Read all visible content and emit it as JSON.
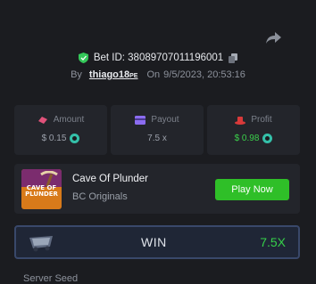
{
  "bet": {
    "id_label": "Bet ID: 38089707011196001",
    "by_label": "By",
    "username": "thiago18",
    "username_suffix": "PE",
    "on_label": "On",
    "date": "9/5/2023, 20:53:16"
  },
  "stats": {
    "amount": {
      "label": "Amount",
      "value": "$ 0.15",
      "color": "#e0527a"
    },
    "payout": {
      "label": "Payout",
      "value": "7.5 x",
      "color": "#8b6cf1"
    },
    "profit": {
      "label": "Profit",
      "value": "$ 0.98",
      "color": "#d93a3a"
    }
  },
  "game": {
    "name": "Cave Of Plunder",
    "category": "BC Originals",
    "thumb_text": "CAVE OF PLUNDER",
    "play_label": "Play Now"
  },
  "result": {
    "label": "WIN",
    "multiplier": "7.5X"
  },
  "seed": {
    "server_label": "Server Seed"
  },
  "colors": {
    "accent_green": "#2fbf28",
    "win_green": "#36d14a",
    "coin": "#34c0a9"
  }
}
